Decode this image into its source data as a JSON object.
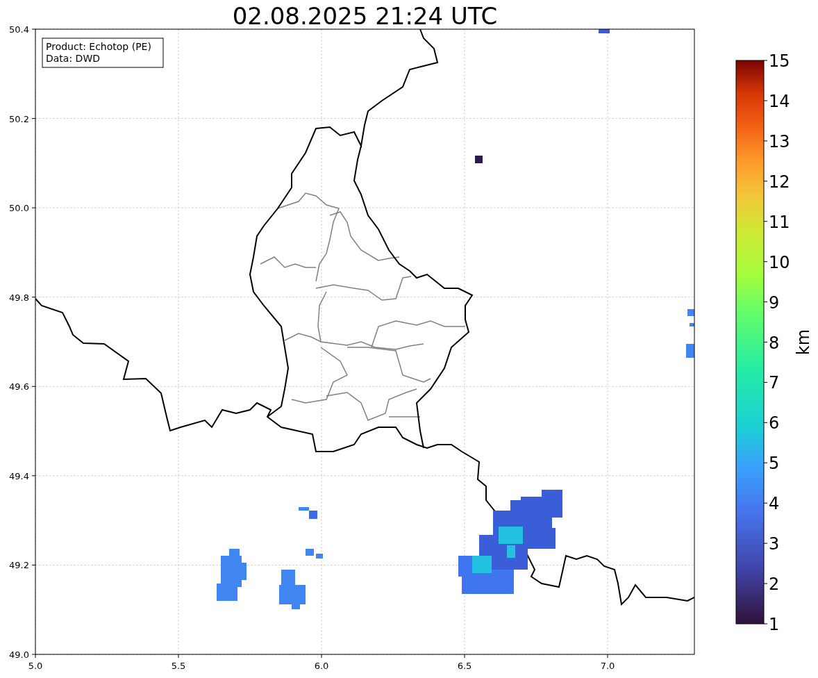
{
  "title": "02.08.2025 21:24 UTC",
  "info_box": {
    "lines": [
      "Product: Echotop (PE)",
      "Data: DWD"
    ]
  },
  "x_axis": {
    "ticks": [
      "5.0",
      "5.5",
      "6.0",
      "6.5",
      "7.0"
    ]
  },
  "y_axis": {
    "ticks": [
      "50.4",
      "50.2",
      "50.0",
      "49.8",
      "49.6",
      "49.4",
      "49.2",
      "49.0"
    ]
  },
  "colorbar": {
    "label": "km",
    "ticks": [
      "15",
      "14",
      "13",
      "12",
      "11",
      "10",
      "9",
      "8",
      "7",
      "6",
      "5",
      "4",
      "3",
      "2",
      "1"
    ]
  }
}
